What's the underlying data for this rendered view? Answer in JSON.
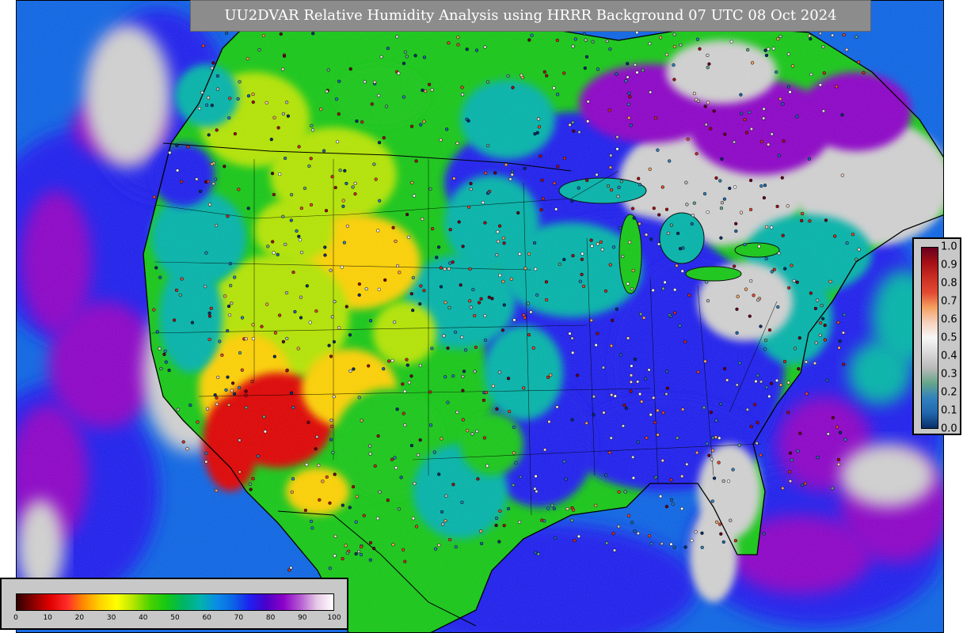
{
  "title": "UU2DVAR Relative Humidity Analysis using HRRR Background 07 UTC 08 Oct 2024",
  "map": {
    "colors": {
      "very_dry": "#e00000",
      "dry": "#ffd200",
      "semi_dry": "#b4e600",
      "moderate": "#14c814",
      "moist": "#00b4aa",
      "humid": "#0a64e6",
      "very_humid": "#1e1ef0",
      "saturated": "#8c00c8",
      "cloud_pale": "#d2d2d2",
      "coastline": "#000000"
    }
  },
  "rh_colorbar": {
    "ticks": [
      "0",
      "10",
      "20",
      "30",
      "40",
      "50",
      "60",
      "70",
      "80",
      "90",
      "100"
    ],
    "colors": [
      "#300000",
      "#8a0000",
      "#e00000",
      "#ff2a2a",
      "#ff8c00",
      "#ffd200",
      "#ffff00",
      "#b4e600",
      "#4ad200",
      "#14c814",
      "#00b464",
      "#00b4aa",
      "#0a8ce6",
      "#0a64e6",
      "#1e1ef0",
      "#4b00c8",
      "#8c00c8",
      "#b45ad2",
      "#e6c8e6",
      "#ffffff"
    ]
  },
  "increment_colorbar": {
    "ticks": [
      "1.0",
      "0.9",
      "0.8",
      "0.7",
      "0.6",
      "0.5",
      "0.4",
      "0.3",
      "0.2",
      "0.1",
      "0.0"
    ],
    "colors": [
      "#67001f",
      "#a50f15",
      "#cb2e23",
      "#e34a33",
      "#f4a261",
      "#f7d1c0",
      "#f7f7f7",
      "#d9d9d9",
      "#bababa",
      "#66a68a",
      "#3182bd",
      "#2166ac",
      "#08306b"
    ]
  }
}
